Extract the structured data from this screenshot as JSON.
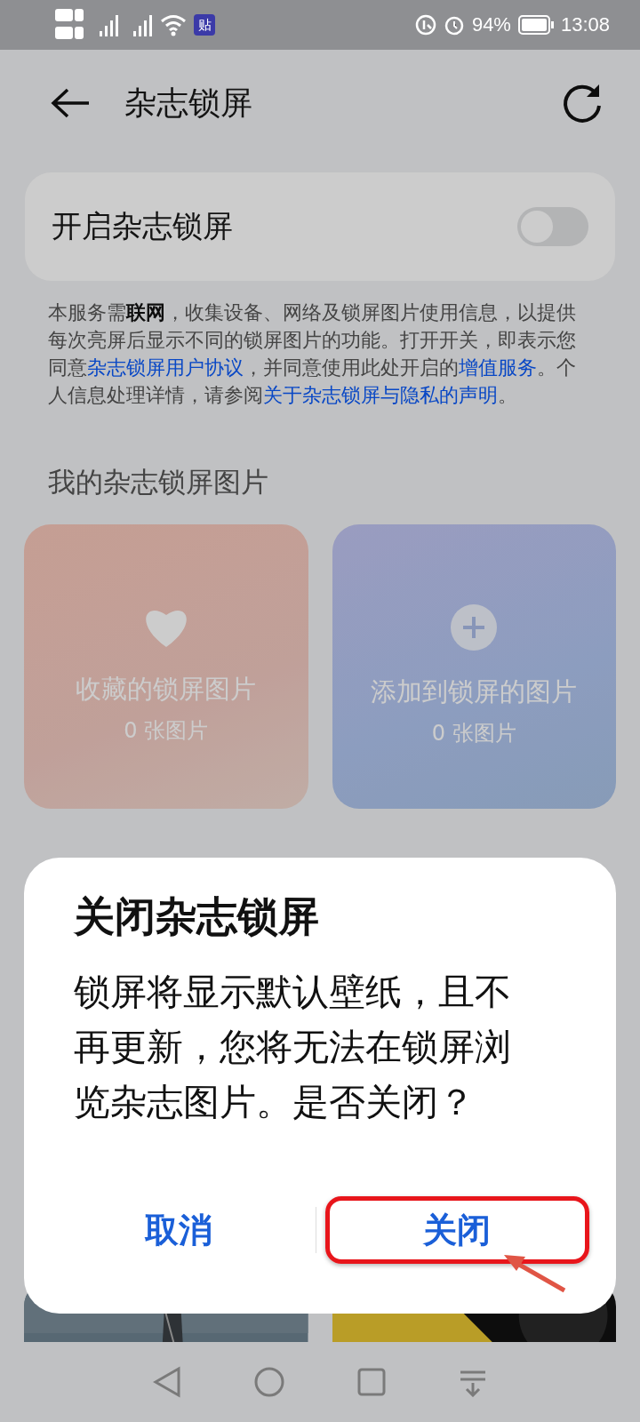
{
  "status_bar": {
    "notification_app": "贴",
    "battery": "94%",
    "time": "13:08"
  },
  "header": {
    "title": "杂志锁屏"
  },
  "switch_card": {
    "label": "开启杂志锁屏",
    "on": false
  },
  "notice": [
    {
      "kind": "plain",
      "text": "本服务需"
    },
    {
      "kind": "bold",
      "text": "联网"
    },
    {
      "kind": "plain",
      "text": "，收集设备、网络及锁屏图片使用信息，以提供每次亮屏后显示不同的锁屏图片的功能。打开开关，即表示您同意"
    },
    {
      "kind": "link",
      "text": "杂志锁屏用户协议"
    },
    {
      "kind": "plain",
      "text": "，并同意使用此处开启的"
    },
    {
      "kind": "link",
      "text": "增值服务"
    },
    {
      "kind": "plain",
      "text": "。个人信息处理详情，请参阅"
    },
    {
      "kind": "link",
      "text": "关于杂志锁屏与隐私的声明"
    },
    {
      "kind": "plain",
      "text": "。"
    }
  ],
  "section_title": "我的杂志锁屏图片",
  "tiles": [
    {
      "kind": "favorites",
      "title": "收藏的锁屏图片",
      "count": "0 张图片"
    },
    {
      "kind": "added",
      "title": "添加到锁屏的图片",
      "count": "0 张图片"
    }
  ],
  "dialog": {
    "title": "关闭杂志锁屏",
    "message": "锁屏将显示默认壁纸，且不再更新，您将无法在锁屏浏览杂志图片。是否关闭？",
    "buttons": [
      {
        "label": "取消",
        "highlighted": false
      },
      {
        "label": "关闭",
        "highlighted": true
      }
    ]
  }
}
